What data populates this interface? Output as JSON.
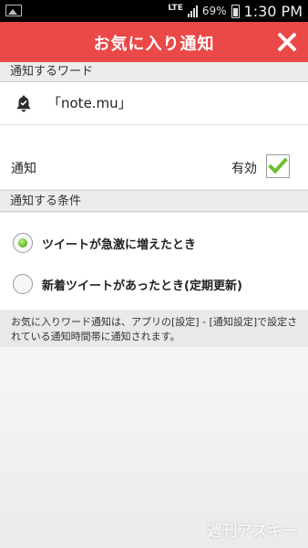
{
  "status_bar": {
    "network": "LTE",
    "battery_pct": "69%",
    "time": "1:30 PM"
  },
  "app_bar": {
    "title": "お気に入り通知",
    "close_icon": "close-icon"
  },
  "section_word": {
    "header": "通知するワード",
    "word": "「note.mu」",
    "word_icon": "bell-check-icon",
    "notify_label": "通知",
    "enabled_label": "有効",
    "enabled_checked": true
  },
  "section_condition": {
    "header": "通知する条件",
    "options": [
      {
        "label": "ツイートが急激に増えたとき",
        "selected": true
      },
      {
        "label": "新着ツイートがあったとき(定期更新)",
        "selected": false
      }
    ]
  },
  "note": "お気に入りワード通知は、アプリの[設定] - [通知設定]で設定されている通知時間帯に通知されます。",
  "watermark": "週刊アスキー",
  "colors": {
    "app_bar": "#eb4848",
    "check": "#6cbf2e",
    "radio_selected": "#5fb52a"
  }
}
